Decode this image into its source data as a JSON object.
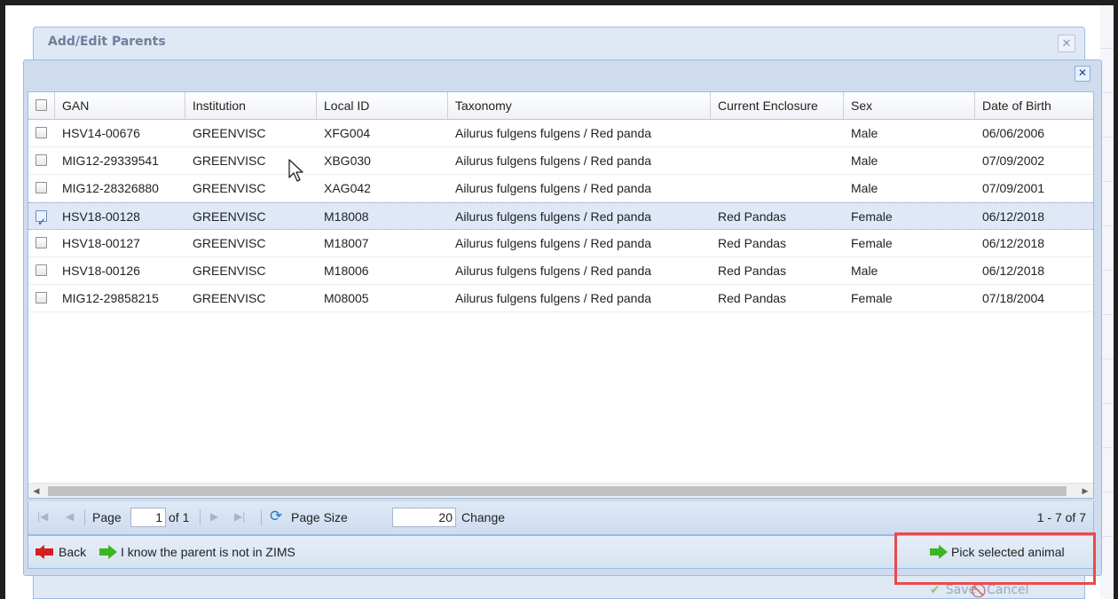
{
  "back_window": {
    "title": "Add/Edit Parents",
    "close_glyph": "✕",
    "save_label": "Save",
    "cancel_label": "Cancel"
  },
  "dialog": {
    "close_glyph": "✕"
  },
  "grid": {
    "columns": [
      "GAN",
      "Institution",
      "Local ID",
      "Taxonomy",
      "Current Enclosure",
      "Sex",
      "Date of Birth"
    ],
    "rows": [
      {
        "gan": "HSV14-00676",
        "institution": "GREENVISC",
        "local_id": "XFG004",
        "taxonomy": "Ailurus fulgens fulgens / Red panda",
        "enclosure": "",
        "sex": "Male",
        "dob": "06/06/2006",
        "checked": false
      },
      {
        "gan": "MIG12-29339541",
        "institution": "GREENVISC",
        "local_id": "XBG030",
        "taxonomy": "Ailurus fulgens fulgens / Red panda",
        "enclosure": "",
        "sex": "Male",
        "dob": "07/09/2002",
        "checked": false
      },
      {
        "gan": "MIG12-28326880",
        "institution": "GREENVISC",
        "local_id": "XAG042",
        "taxonomy": "Ailurus fulgens fulgens / Red panda",
        "enclosure": "",
        "sex": "Male",
        "dob": "07/09/2001",
        "checked": false
      },
      {
        "gan": "HSV18-00128",
        "institution": "GREENVISC",
        "local_id": "M18008",
        "taxonomy": "Ailurus fulgens fulgens / Red panda",
        "enclosure": "Red Pandas",
        "sex": "Female",
        "dob": "06/12/2018",
        "checked": true
      },
      {
        "gan": "HSV18-00127",
        "institution": "GREENVISC",
        "local_id": "M18007",
        "taxonomy": "Ailurus fulgens fulgens / Red panda",
        "enclosure": "Red Pandas",
        "sex": "Female",
        "dob": "06/12/2018",
        "checked": false
      },
      {
        "gan": "HSV18-00126",
        "institution": "GREENVISC",
        "local_id": "M18006",
        "taxonomy": "Ailurus fulgens fulgens / Red panda",
        "enclosure": "Red Pandas",
        "sex": "Male",
        "dob": "06/12/2018",
        "checked": false
      },
      {
        "gan": "MIG12-29858215",
        "institution": "GREENVISC",
        "local_id": "M08005",
        "taxonomy": "Ailurus fulgens fulgens / Red panda",
        "enclosure": "Red Pandas",
        "sex": "Female",
        "dob": "07/18/2004",
        "checked": false
      }
    ]
  },
  "pager": {
    "page_label": "Page",
    "page_value": "1",
    "of_label": "of 1",
    "page_size_label": "Page Size",
    "page_size_value": "20",
    "change_label": "Change",
    "summary": "1 - 7 of 7"
  },
  "toolbar": {
    "back_label": "Back",
    "not_in_zims_label": "I know the parent is not in ZIMS",
    "pick_label": "Pick selected animal"
  },
  "colors": {
    "accent_border": "#99bbe8",
    "selected_row": "#dfe8f6",
    "highlight_box": "#e84b4b",
    "back_arrow": "#d42020",
    "forward_arrow": "#3bb524"
  }
}
